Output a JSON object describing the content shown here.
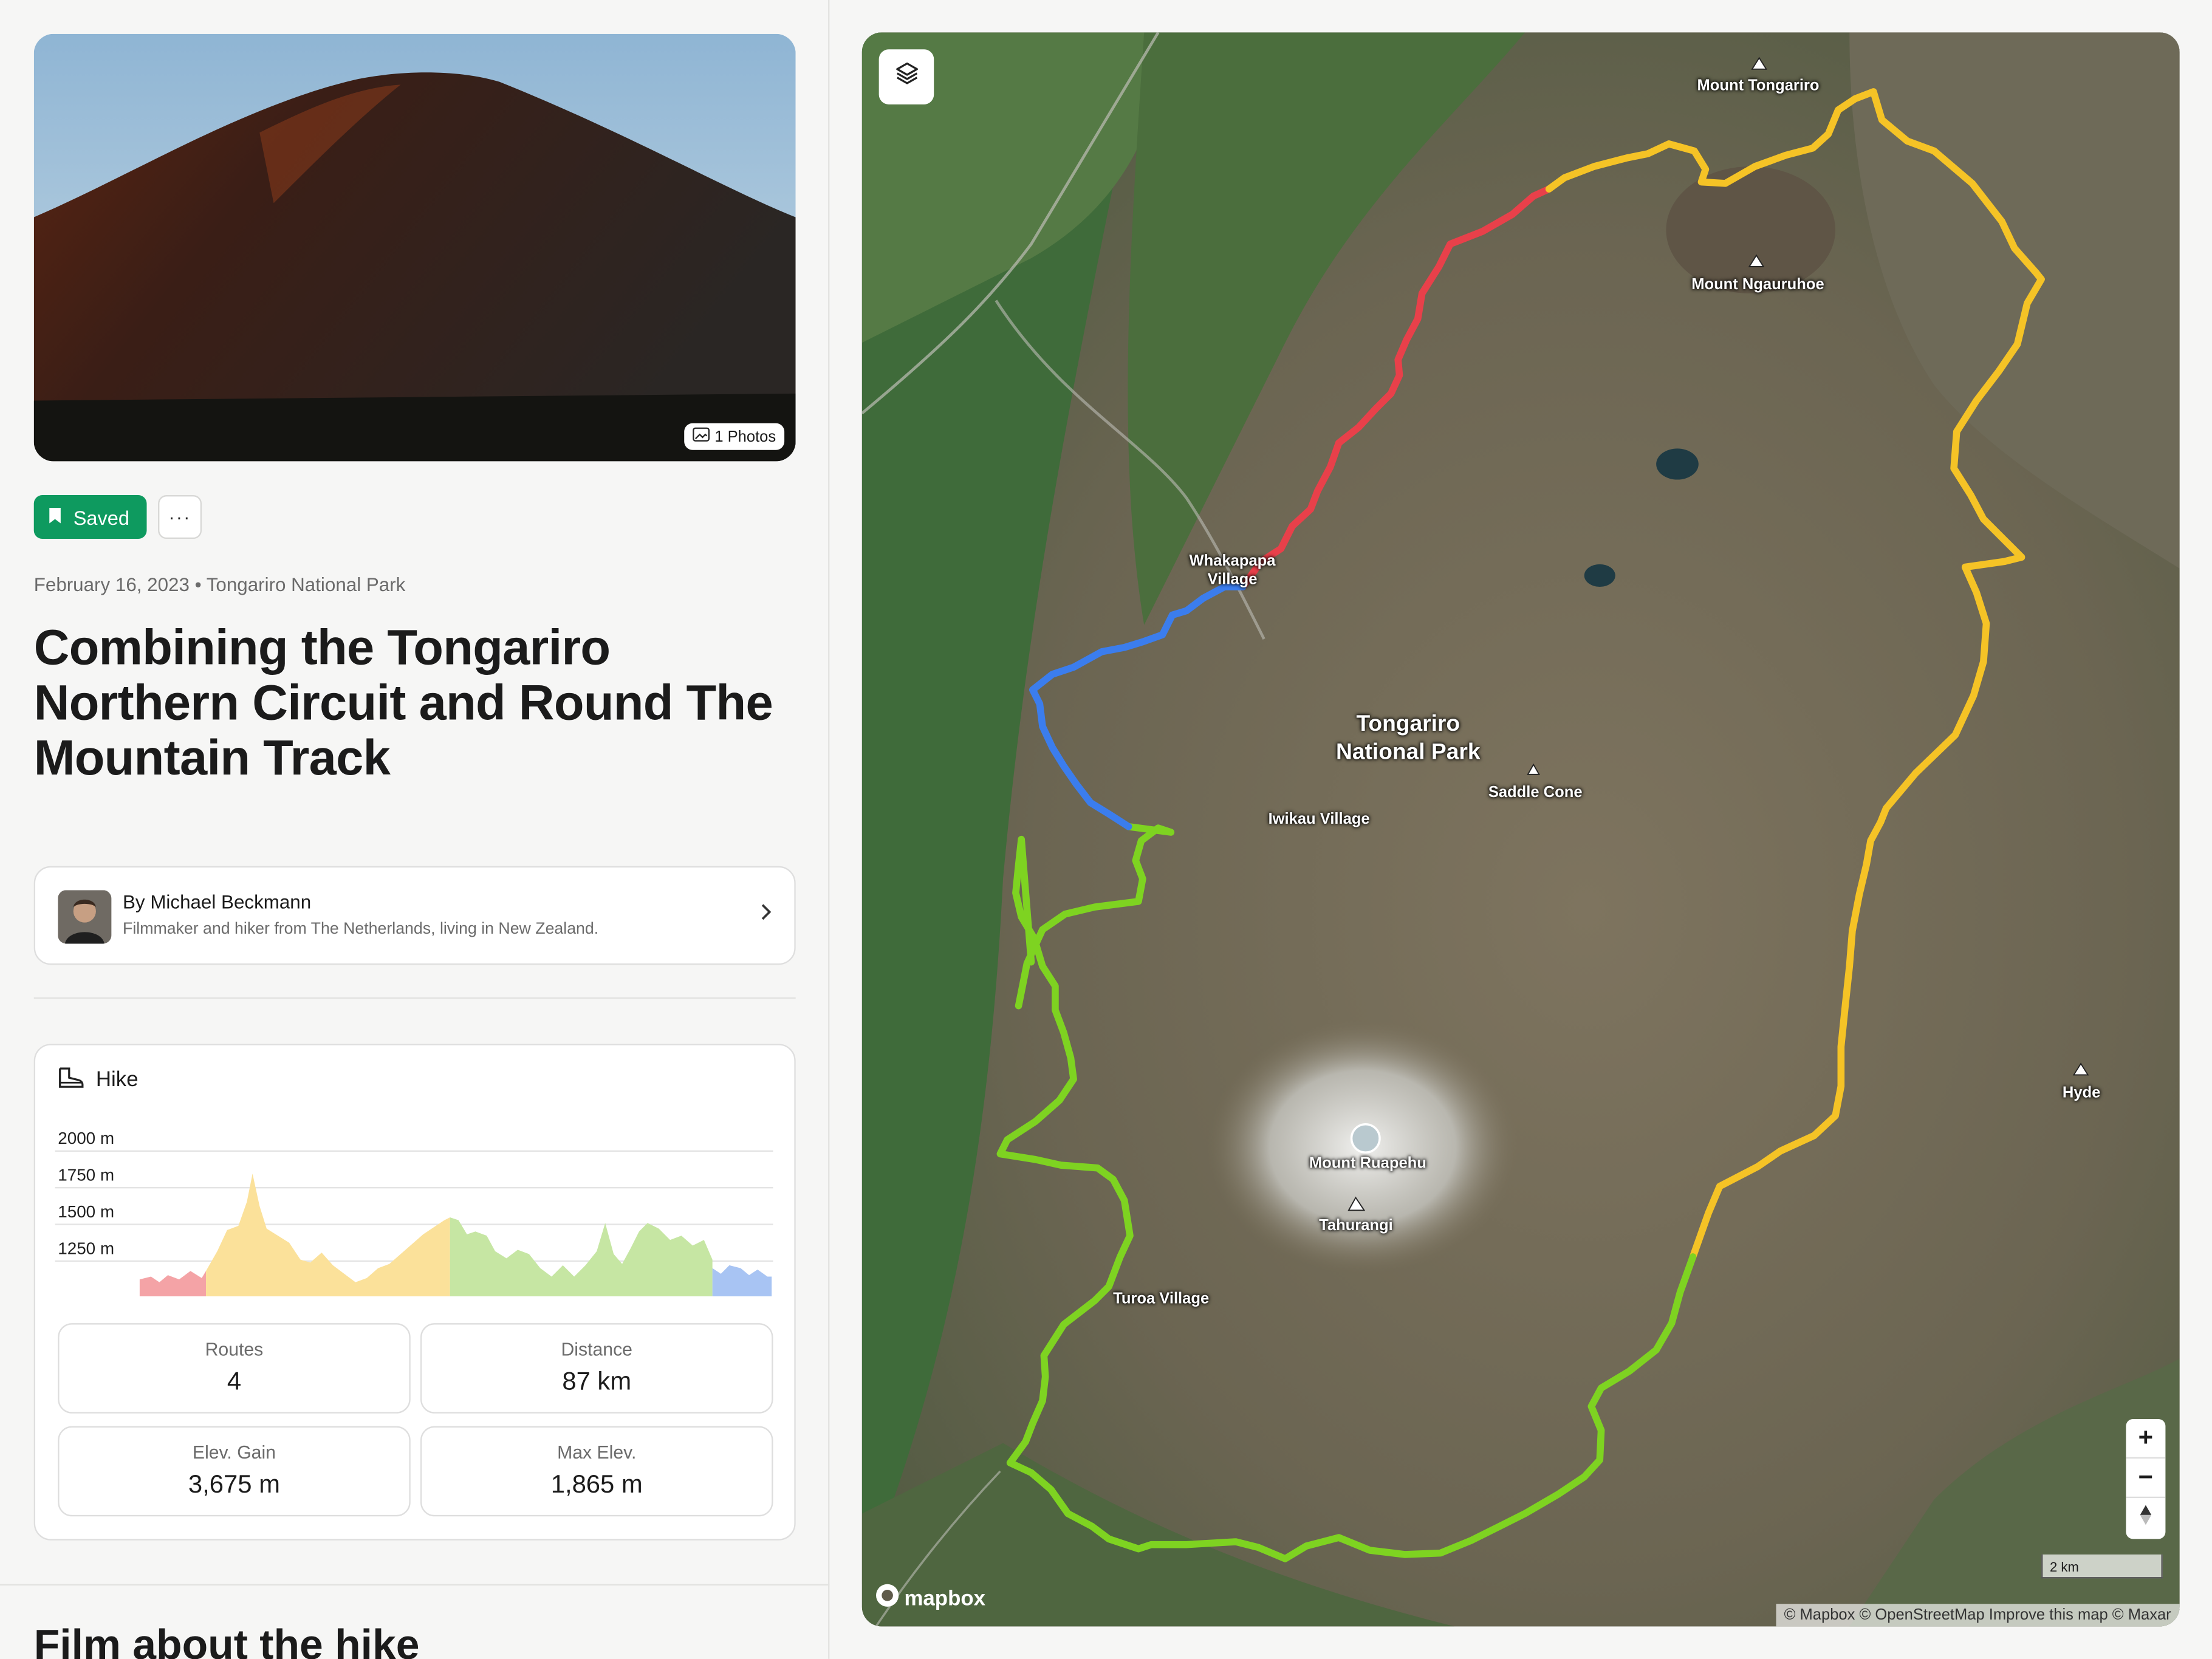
{
  "hero": {
    "photos_badge": "1 Photos"
  },
  "actions": {
    "saved_label": "Saved",
    "more_label": "···"
  },
  "meta": {
    "date": "February 16, 2023",
    "location": "Tongariro National Park",
    "separator": " • "
  },
  "title": "Combining the Tongariro Northern Circuit and Round The Mountain Track",
  "author": {
    "name": "By Michael Beckmann",
    "bio": "Filmmaker and hiker from The Netherlands, living in New Zealand."
  },
  "stats": {
    "activity": "Hike",
    "y_ticks": [
      "2000 m",
      "1750 m",
      "1500 m",
      "1250 m"
    ],
    "cards": [
      {
        "label": "Routes",
        "value": "4"
      },
      {
        "label": "Distance",
        "value": "87 km"
      },
      {
        "label": "Elev. Gain",
        "value": "3,675 m"
      },
      {
        "label": "Max Elev.",
        "value": "1,865 m"
      }
    ]
  },
  "section_title": "Film about the hike",
  "map": {
    "labels": {
      "mount_tongariro": "Mount Tongariro",
      "mount_ngauruhoe": "Mount Ngauruhoe",
      "whakapapa": "Whakapapa\nVillage",
      "park": "Tongariro\nNational Park",
      "saddle_cone": "Saddle Cone",
      "iwikau": "Iwikau Village",
      "hyde": "Hyde",
      "ruapehu": "Mount Ruapehu",
      "tahurangi": "Tahurangi",
      "turoa": "Turoa Village"
    },
    "scale": "2 km",
    "logo": "mapbox",
    "attribution": "© Mapbox © OpenStreetMap Improve this map © Maxar",
    "route_colors": {
      "red": "#e8404a",
      "yellow": "#f5c326",
      "green": "#7ed321",
      "blue": "#3b7ded"
    }
  }
}
